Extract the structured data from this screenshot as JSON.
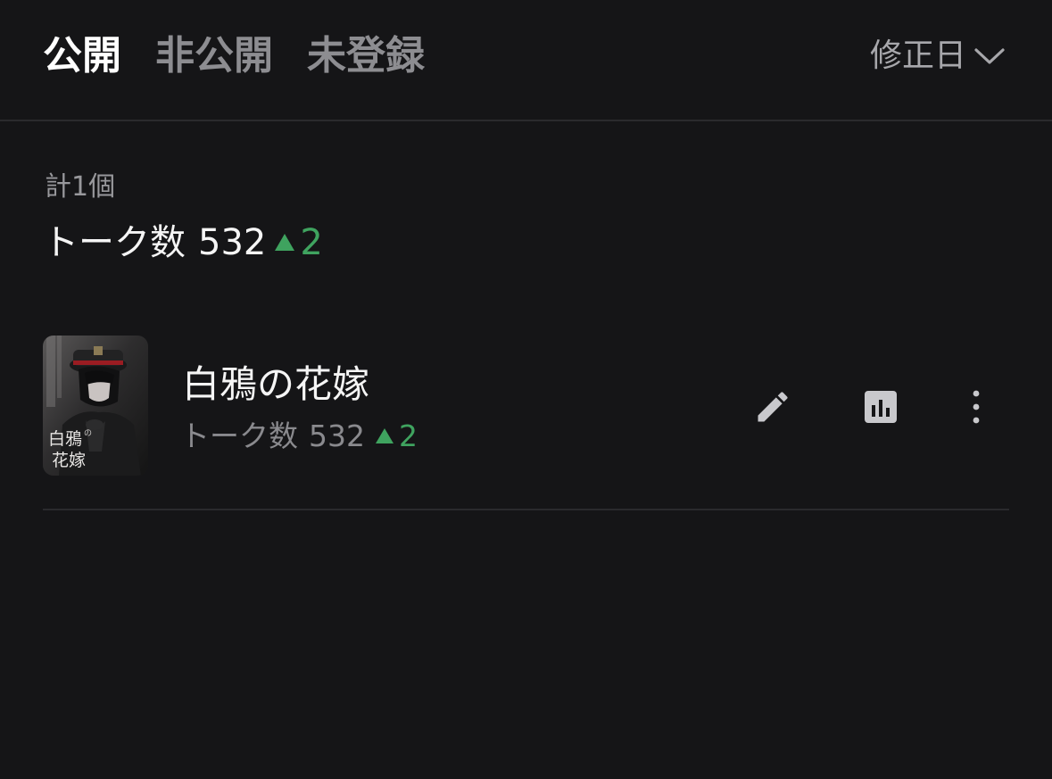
{
  "tabs": {
    "public": "公開",
    "private": "非公開",
    "unregistered": "未登録"
  },
  "sort": {
    "label": "修正日",
    "icon": "chevron-down-icon"
  },
  "summary": {
    "count_label": "計1個",
    "talk_label": "トーク数",
    "talk_count": "532",
    "talk_delta": "2"
  },
  "items": [
    {
      "title": "白鴉の花嫁",
      "talk_label": "トーク数",
      "talk_count": "532",
      "talk_delta": "2",
      "thumbnail_text": "白鴉の花嫁",
      "actions": [
        "pencil-icon",
        "bar-chart-icon",
        "more-vertical-icon"
      ]
    }
  ],
  "colors": {
    "background": "#151517",
    "active_tab": "#ffffff",
    "inactive_tab": "#8d8d91",
    "increase": "#3fa35f",
    "icon": "#c8c8cc"
  }
}
